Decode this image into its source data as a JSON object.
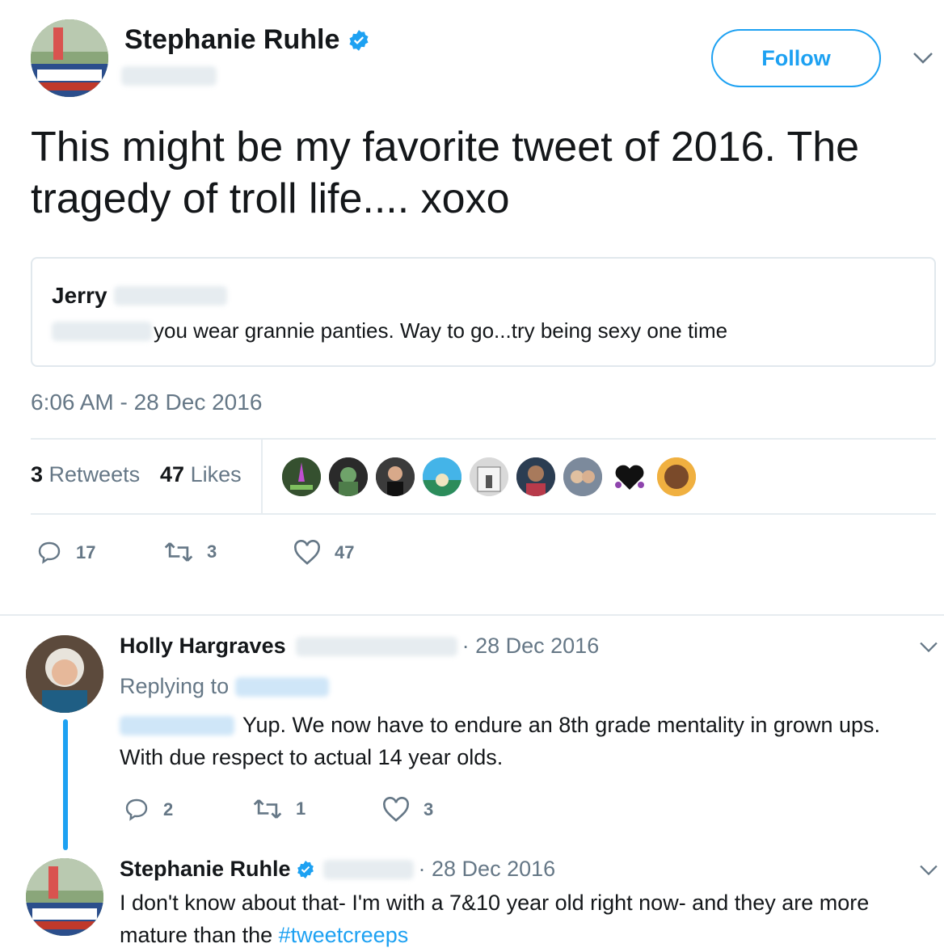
{
  "main_tweet": {
    "author_name": "Stephanie Ruhle",
    "follow_label": "Follow",
    "text": "This might be my favorite tweet of 2016. The tragedy of troll life.... xoxo",
    "quoted": {
      "author_name": "Jerry",
      "text": "you wear grannie panties. Way to go...try being sexy one time"
    },
    "timestamp": "6:06 AM - 28 Dec 2016",
    "stats": {
      "retweets_count": "3",
      "retweets_label": "Retweets",
      "likes_count": "47",
      "likes_label": "Likes"
    },
    "actions": {
      "replies": "17",
      "retweets": "3",
      "likes": "47"
    },
    "liker_avatar_icons": [
      "avatar-1",
      "avatar-2",
      "avatar-3",
      "avatar-4",
      "avatar-5",
      "avatar-6",
      "avatar-7",
      "avatar-8",
      "avatar-9"
    ]
  },
  "replies": [
    {
      "author_name": "Holly Hargraves",
      "date": "· 28 Dec 2016",
      "replying_to_label": "Replying to",
      "text_line1": "Yup. We now have to endure an 8th grade mentality in grown ups.",
      "text_line2": "With due respect to actual 14 year olds.",
      "actions": {
        "replies": "2",
        "retweets": "1",
        "likes": "3"
      }
    },
    {
      "author_name": "Stephanie Ruhle",
      "date": "· 28 Dec 2016",
      "text_line1": "I don't know about that- I'm with a 7&10 year old right now- and they are more",
      "text_line2_prefix": "mature than the ",
      "hashtag": "#tweetcreeps"
    }
  ],
  "colors": {
    "accent": "#1da1f2",
    "muted": "#657786",
    "thread_line": "#1da1f2"
  }
}
